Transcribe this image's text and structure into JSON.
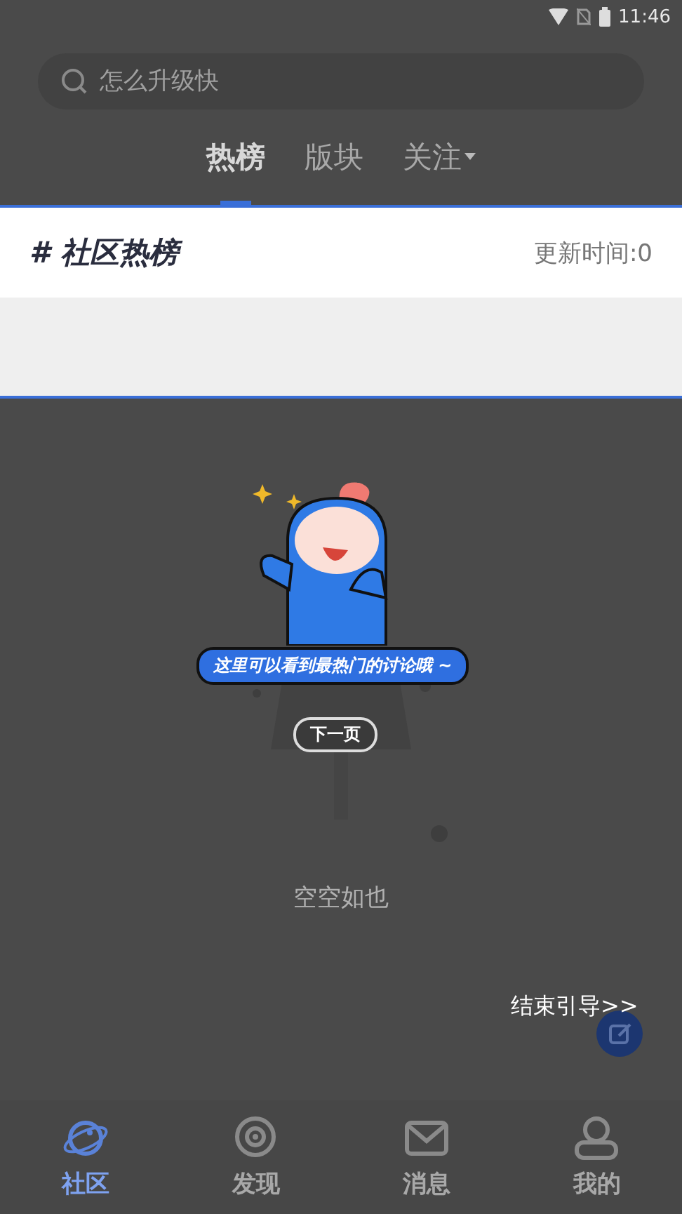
{
  "status_bar": {
    "time": "11:46"
  },
  "search": {
    "placeholder": "怎么升级快"
  },
  "tabs": [
    {
      "label": "热榜",
      "selected": true,
      "dropdown": false
    },
    {
      "label": "版块",
      "selected": false,
      "dropdown": false
    },
    {
      "label": "关注",
      "selected": false,
      "dropdown": true
    }
  ],
  "hot_list": {
    "title": "# 社区热榜",
    "update_label": "更新时间:0"
  },
  "empty_state": {
    "message": "空空如也"
  },
  "guide": {
    "bubble_text": "这里可以看到最热门的讨论哦 ~",
    "next_button": "下一页",
    "end_link": "结束引导>>"
  },
  "bottom_nav": [
    {
      "label": "社区",
      "selected": true
    },
    {
      "label": "发现",
      "selected": false
    },
    {
      "label": "消息",
      "selected": false
    },
    {
      "label": "我的",
      "selected": false
    }
  ]
}
